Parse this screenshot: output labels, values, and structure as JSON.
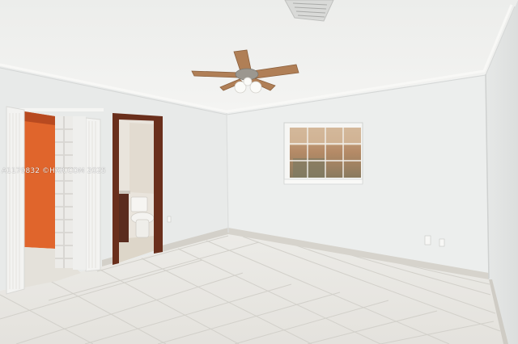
{
  "photo": {
    "subject": "empty bedroom with tile floor, ceiling fan, open closet and bathroom door",
    "watermark_text": "A1179832 ©HAR.COM 2025"
  },
  "colors": {
    "ceiling": "#f2f2f0",
    "wall_left": "#e9ebea",
    "wall_back": "#eceeed",
    "wall_right": "#e2e4e3",
    "floor_tile": "#e8e7e3",
    "grout": "#cfcdc7",
    "baseboard": "#d8d5ce",
    "closet_interior": "#e0652c",
    "door_frame": "#6a2f1c",
    "fan_blade": "#b07f56"
  }
}
